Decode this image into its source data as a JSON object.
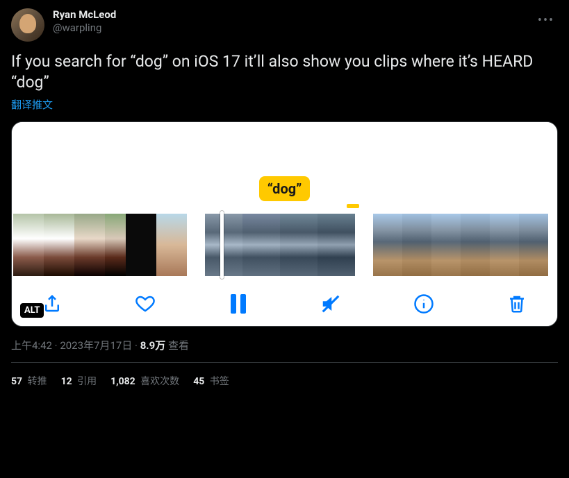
{
  "author": {
    "display_name": "Ryan McLeod",
    "handle": "@warpling"
  },
  "tweet_text": "If you search for “dog” on iOS 17 it’ll also show you clips where it’s HEARD “dog”",
  "translate_label": "翻译推文",
  "media": {
    "search_tag": "“dog”",
    "alt_badge": "ALT",
    "toolbar": {
      "share": "share-icon",
      "like": "heart-icon",
      "playpause": "pause-icon",
      "mute": "mute-icon",
      "info": "info-icon",
      "trash": "trash-icon"
    }
  },
  "meta": {
    "time": "上午4:42",
    "sep1": " · ",
    "date": "2023年7月17日",
    "sep2": " · ",
    "views_count": "8.9万",
    "views_label": " 查看"
  },
  "engagement": {
    "retweets_count": "57",
    "retweets_label": " 转推",
    "quotes_count": "12",
    "quotes_label": " 引用",
    "likes_count": "1,082",
    "likes_label": " 喜欢次数",
    "bookmarks_count": "45",
    "bookmarks_label": " 书签"
  }
}
